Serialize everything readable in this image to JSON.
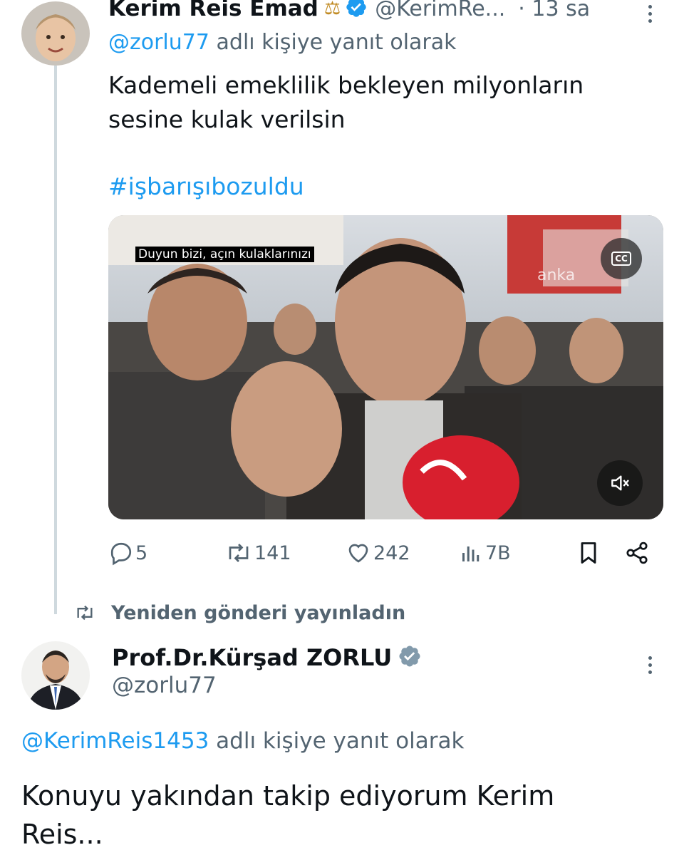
{
  "tweet1": {
    "display_name": "Kerim Reis Emad",
    "name_emoji": "⚖",
    "handle": "@KerimRe...",
    "time": "· 13 sa",
    "reply_prefix_handle": "@zorlu77",
    "reply_suffix": "adlı kişiye yanıt olarak",
    "text_line1": "Kademeli emeklilik bekleyen milyonların",
    "text_line2": "sesine kulak verilsin",
    "hashtag": "#işbarışıbozuldu",
    "video_caption": "Duyun bizi, açın kulaklarınızı",
    "cc_label": "CC",
    "watermark": "anka",
    "stats": {
      "replies": "5",
      "retweets": "141",
      "likes": "242",
      "views": "7B"
    }
  },
  "repost_banner": {
    "text": "Yeniden gönderi yayınladın"
  },
  "tweet2": {
    "display_name": "Prof.Dr.Kürşad ZORLU",
    "handle": "@zorlu77",
    "reply_prefix_handle": "@KerimReis1453",
    "reply_suffix": "adlı kişiye yanıt olarak",
    "text_line1": "Konuyu yakından takip ediyorum Kerim",
    "text_line2": "Reis..."
  },
  "colors": {
    "link": "#1d9bf0",
    "muted": "#536471",
    "verified_blue": "#1d9bf0",
    "verified_gray": "#829aab",
    "text": "#0f1419"
  },
  "icons": {
    "reply": "reply-icon",
    "retweet": "retweet-icon",
    "like": "heart-icon",
    "views": "views-icon",
    "bookmark": "bookmark-icon",
    "share": "share-icon",
    "more": "more-icon",
    "mute": "mute-icon",
    "cc": "cc-icon"
  }
}
